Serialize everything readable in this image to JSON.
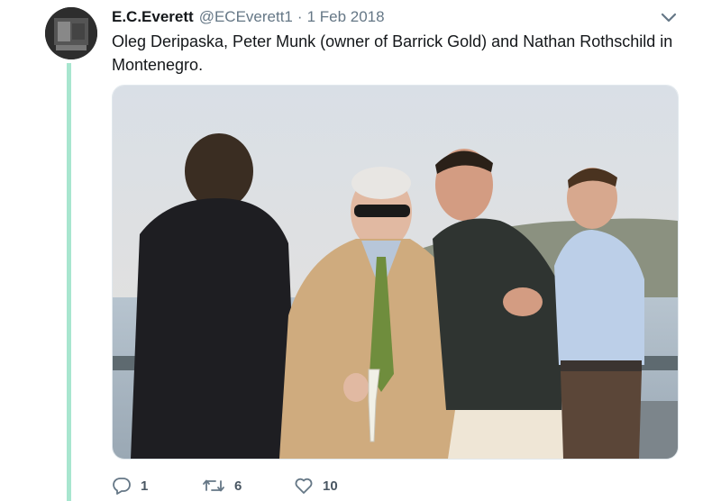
{
  "tweet": {
    "author_name": "E.C.Everett",
    "handle": "@ECEverett1",
    "separator": "·",
    "date": "1 Feb 2018",
    "text": "Oleg Deripaska, Peter Munk (owner of Barrick Gold) and Nathan Rothschild in Montenegro."
  },
  "actions": {
    "reply_count": "1",
    "retweet_count": "6",
    "like_count": "10"
  },
  "icons": {
    "menu": "chevron-down-icon",
    "reply": "reply-icon",
    "retweet": "retweet-icon",
    "like": "heart-icon"
  },
  "colors": {
    "thread_line": "#a8e6cf",
    "secondary_text": "#657786"
  }
}
